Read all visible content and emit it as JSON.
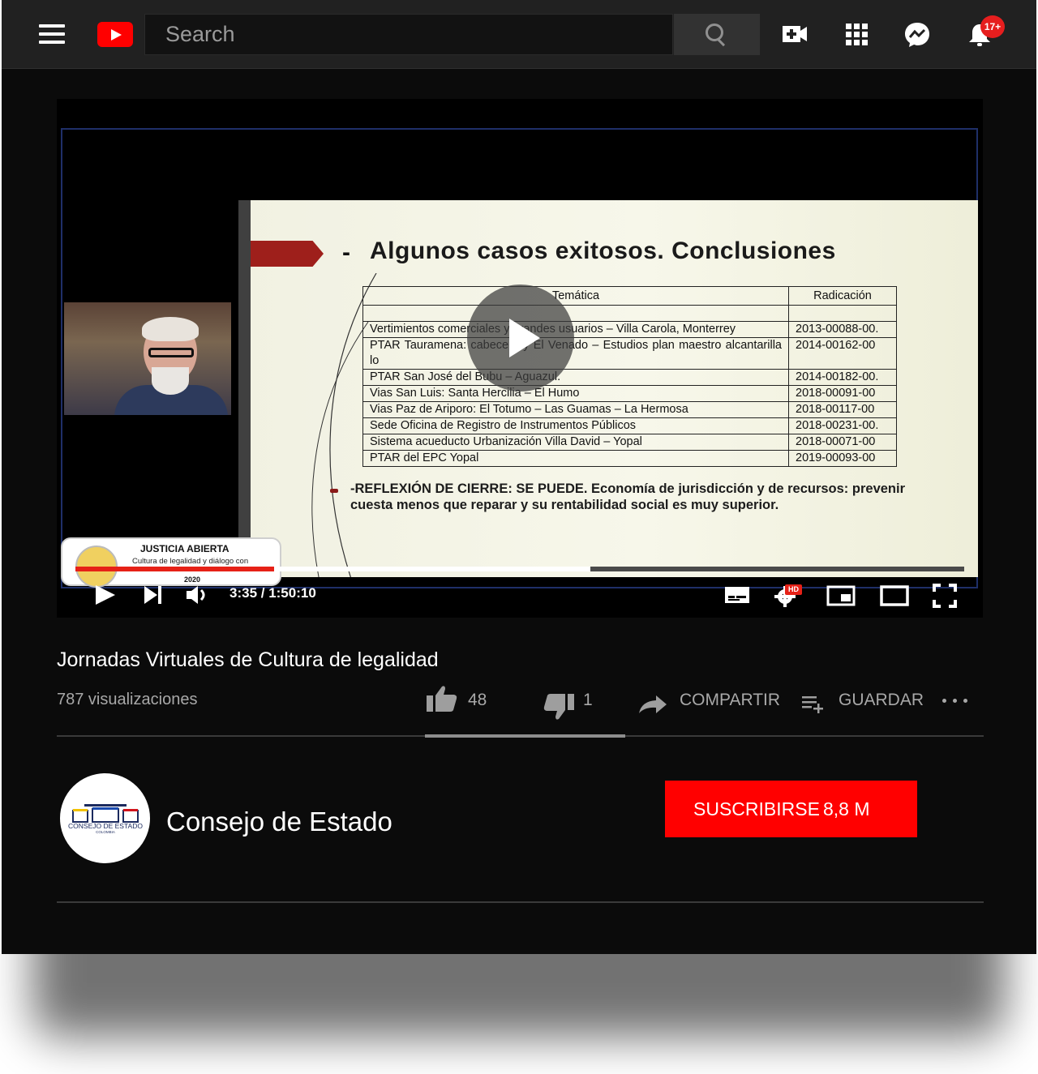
{
  "search": {
    "placeholder": "Search"
  },
  "notifications": {
    "badge": "17+"
  },
  "slide": {
    "dash": "-",
    "title": "Algunos casos exitosos. Conclusiones",
    "table": {
      "headers": [
        "Temática",
        "Radicación"
      ],
      "rows": [
        {
          "tematica": "",
          "radicacion": ""
        },
        {
          "tematica": "Vertimientos comerciales y grandes usuarios – Villa Carola, Monterrey",
          "radicacion": "2013-00088-00."
        },
        {
          "tematica": "PTAR  Tauramena:  cabecera  y  El  Venado  –  Estudios  plan  maestro alcantarilla lo",
          "radicacion": "2014-00162-00"
        },
        {
          "tematica": "PTAR San José del Bubu – Aguazul.",
          "radicacion": "2014-00182-00."
        },
        {
          "tematica": "Vias San Luis: Santa Hercilia – El Humo",
          "radicacion": "2018-00091-00"
        },
        {
          "tematica": "Vias Paz de Ariporo: El Totumo – Las Guamas – La Hermosa",
          "radicacion": "2018-00117-00"
        },
        {
          "tematica": "Sede Oficina de Registro de Instrumentos Públicos",
          "radicacion": "2018-00231-00."
        },
        {
          "tematica": "Sistema acueducto Urbanización Villa David – Yopal",
          "radicacion": "2018-00071-00"
        },
        {
          "tematica": "PTAR del EPC Yopal",
          "radicacion": "2019-00093-00"
        }
      ]
    },
    "closing": "-REFLEXIÓN DE CIERRE: SE PUEDE. Economía de jurisdicción y de recursos: prevenir cuesta menos que reparar y su rentabilidad social es muy superior."
  },
  "overlay": {
    "title": "JUSTICIA ABIERTA",
    "subtitle": "Cultura de legalidad y diálogo con",
    "year": "2020"
  },
  "player": {
    "time": "3:35 / 1:50:10",
    "progress_fraction": 0.579,
    "hd_label": "HD"
  },
  "video": {
    "title": "Jornadas Virtuales de Cultura de legalidad",
    "views": "787 visualizaciones",
    "likes": "48",
    "dislikes": "1",
    "share_label": "COMPARTIR",
    "save_label": "GUARDAR",
    "like_fraction": 0.98
  },
  "channel": {
    "name": "Consejo de Estado",
    "logo_text": "CONSEJO DE ESTADO",
    "logo_subtext": "COLOMBIA",
    "subscribe_label": "SUSCRIBIRSE",
    "subscriber_count": "8,8 M"
  },
  "colors": {
    "accent": "#ff0000",
    "background": "#0b0b0b",
    "topbar": "#212121"
  },
  "icons": [
    "menu-icon",
    "youtube-logo-icon",
    "search-icon",
    "create-video-icon",
    "apps-icon",
    "messages-icon",
    "bell-icon",
    "play-icon",
    "next-icon",
    "volume-icon",
    "subtitles-icon",
    "settings-icon",
    "miniplayer-icon",
    "theater-icon",
    "fullscreen-icon",
    "thumbs-up-icon",
    "thumbs-down-icon",
    "share-icon",
    "playlist-add-icon",
    "more-icon"
  ]
}
